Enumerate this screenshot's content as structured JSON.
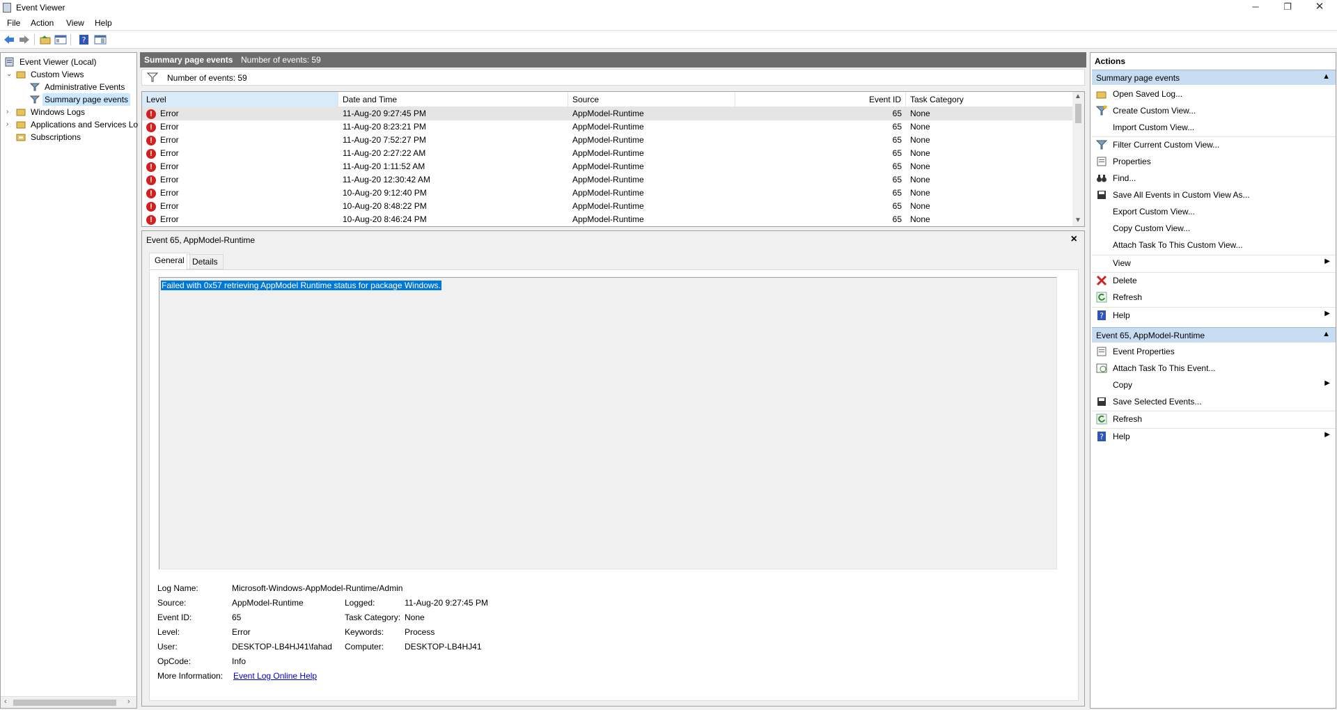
{
  "window": {
    "title": "Event Viewer",
    "minimize": "─",
    "restore": "❐",
    "close": "✕"
  },
  "menu": [
    "File",
    "Action",
    "View",
    "Help"
  ],
  "toolbar_icons": [
    "back-icon",
    "forward-icon",
    "open-folder-icon",
    "console-tree-icon",
    "help-icon",
    "action-pane-icon"
  ],
  "tree": {
    "root": "Event Viewer (Local)",
    "custom_views": "Custom Views",
    "admin_events": "Administrative Events",
    "summary_events": "Summary page events",
    "windows_logs": "Windows Logs",
    "apps_services": "Applications and Services Lo",
    "subscriptions": "Subscriptions"
  },
  "center": {
    "header_title": "Summary page events",
    "header_count": "Number of events: 59",
    "filter_text": "Number of events: 59",
    "columns": [
      "Level",
      "Date and Time",
      "Source",
      "Event ID",
      "Task Category"
    ],
    "rows": [
      [
        "Error",
        "11-Aug-20 9:27:45 PM",
        "AppModel-Runtime",
        "65",
        "None"
      ],
      [
        "Error",
        "11-Aug-20 8:23:21 PM",
        "AppModel-Runtime",
        "65",
        "None"
      ],
      [
        "Error",
        "11-Aug-20 7:52:27 PM",
        "AppModel-Runtime",
        "65",
        "None"
      ],
      [
        "Error",
        "11-Aug-20 2:27:22 AM",
        "AppModel-Runtime",
        "65",
        "None"
      ],
      [
        "Error",
        "11-Aug-20 1:11:52 AM",
        "AppModel-Runtime",
        "65",
        "None"
      ],
      [
        "Error",
        "11-Aug-20 12:30:42 AM",
        "AppModel-Runtime",
        "65",
        "None"
      ],
      [
        "Error",
        "10-Aug-20 9:12:40 PM",
        "AppModel-Runtime",
        "65",
        "None"
      ],
      [
        "Error",
        "10-Aug-20 8:48:22 PM",
        "AppModel-Runtime",
        "65",
        "None"
      ],
      [
        "Error",
        "10-Aug-20 8:46:24 PM",
        "AppModel-Runtime",
        "65",
        "None"
      ]
    ]
  },
  "detail": {
    "title": "Event 65, AppModel-Runtime",
    "tabs": [
      "General",
      "Details"
    ],
    "description": "Failed with 0x57 retrieving AppModel Runtime status for package Windows.",
    "labels": {
      "log_name": "Log Name:",
      "source": "Source:",
      "event_id": "Event ID:",
      "level": "Level:",
      "user": "User:",
      "opcode": "OpCode:",
      "more_info": "More Information:",
      "logged": "Logged:",
      "task_category": "Task Category:",
      "keywords": "Keywords:",
      "computer": "Computer:"
    },
    "values": {
      "log_name": "Microsoft-Windows-AppModel-Runtime/Admin",
      "source": "AppModel-Runtime",
      "event_id": "65",
      "level": "Error",
      "user": "DESKTOP-LB4HJ41\\fahad",
      "opcode": "Info",
      "more_info_link": "Event Log Online Help",
      "logged": "11-Aug-20 9:27:45 PM",
      "task_category": "None",
      "keywords": "Process",
      "computer": "DESKTOP-LB4HJ41"
    }
  },
  "actions": {
    "title": "Actions",
    "section1": "Summary page events",
    "items1": [
      "Open Saved Log...",
      "Create Custom View...",
      "Import Custom View...",
      "Filter Current Custom View...",
      "Properties",
      "Find...",
      "Save All Events in Custom View As...",
      "Export Custom View...",
      "Copy Custom View...",
      "Attach Task To This Custom View...",
      "View",
      "Delete",
      "Refresh",
      "Help"
    ],
    "section2": "Event 65, AppModel-Runtime",
    "items2": [
      "Event Properties",
      "Attach Task To This Event...",
      "Copy",
      "Save Selected Events...",
      "Refresh",
      "Help"
    ]
  },
  "colors": {
    "selection_blue": "#0078d7",
    "section_header": "#c7dbf1",
    "error_red": "#d12020",
    "header_gray": "#6d6d6d"
  }
}
